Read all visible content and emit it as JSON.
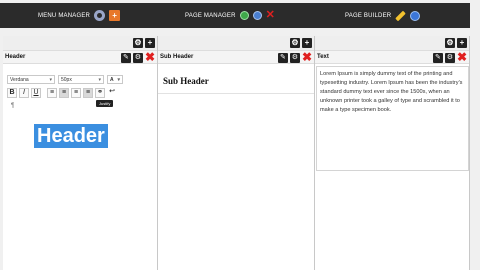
{
  "topbar": {
    "menu_manager": {
      "label": "MENU MANAGER",
      "icons": [
        "gear-icon",
        "add-page-icon"
      ]
    },
    "page_manager": {
      "label": "PAGE MANAGER",
      "icons": [
        "green-status-icon",
        "blue-info-icon",
        "delete-icon"
      ]
    },
    "page_builder": {
      "label": "PAGE BUILDER",
      "icons": [
        "pencil-icon",
        "globe-icon"
      ]
    }
  },
  "columns": [
    {
      "title": "Header",
      "toolbar_icons": [
        "gear-icon",
        "plus-icon"
      ],
      "head_icons": [
        "edit-icon",
        "gear-icon",
        "close-icon"
      ]
    },
    {
      "title": "Sub Header",
      "toolbar_icons": [
        "gear-icon",
        "plus-icon"
      ],
      "head_icons": [
        "edit-icon",
        "gear-icon",
        "close-icon"
      ]
    },
    {
      "title": "Text",
      "toolbar_icons": [
        "gear-icon",
        "plus-icon"
      ],
      "head_icons": [
        "edit-icon",
        "gear-icon",
        "close-icon"
      ]
    }
  ],
  "editor": {
    "font_family": "Verdana",
    "font_size": "50px",
    "font_color_label": "A",
    "format_buttons": [
      "B",
      "I",
      "U"
    ],
    "align_buttons": [
      "align-left",
      "align-center",
      "align-right",
      "justify"
    ],
    "tooltip": "Justify",
    "paragraph_mark": "¶",
    "content": "Header"
  },
  "sub_header": {
    "content": "Sub Header"
  },
  "text_block": {
    "content": "Lorem Ipsum is simply dummy text of the printing and typesetting industry. Lorem Ipsum has been the industry's standard dummy text ever since the 1500s, when an unknown printer took a galley of type and scrambled it to make a type specimen book."
  }
}
